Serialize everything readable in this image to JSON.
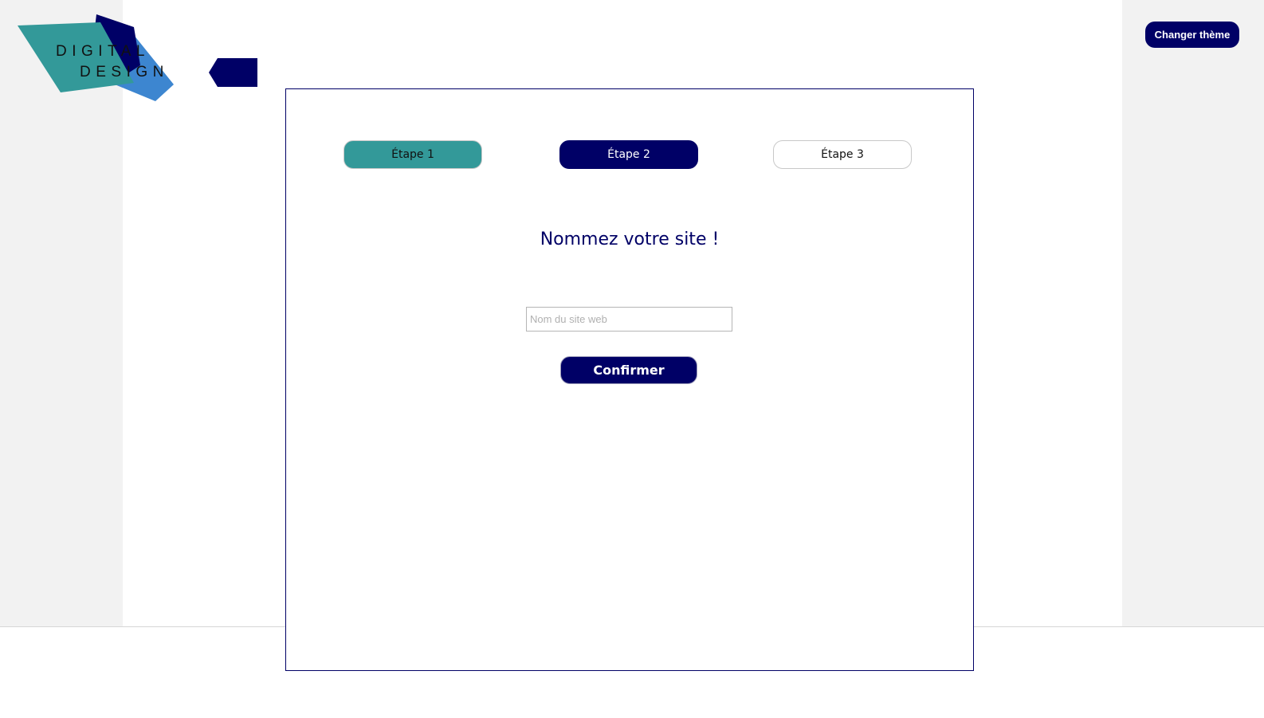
{
  "logo": {
    "line1": "DIGITAL",
    "line2": "DESIGN"
  },
  "header": {
    "theme_button": "Changer thème"
  },
  "steps": [
    {
      "label": "Étape 1"
    },
    {
      "label": "Étape 2"
    },
    {
      "label": "Étape 3"
    }
  ],
  "form": {
    "title": "Nommez votre site !",
    "input_placeholder": "Nom du site web",
    "input_value": "",
    "confirm_label": "Confirmer"
  },
  "colors": {
    "navy": "#000066",
    "teal": "#339999",
    "blue": "#3d86d0",
    "side_gray": "#f2f2f2"
  }
}
